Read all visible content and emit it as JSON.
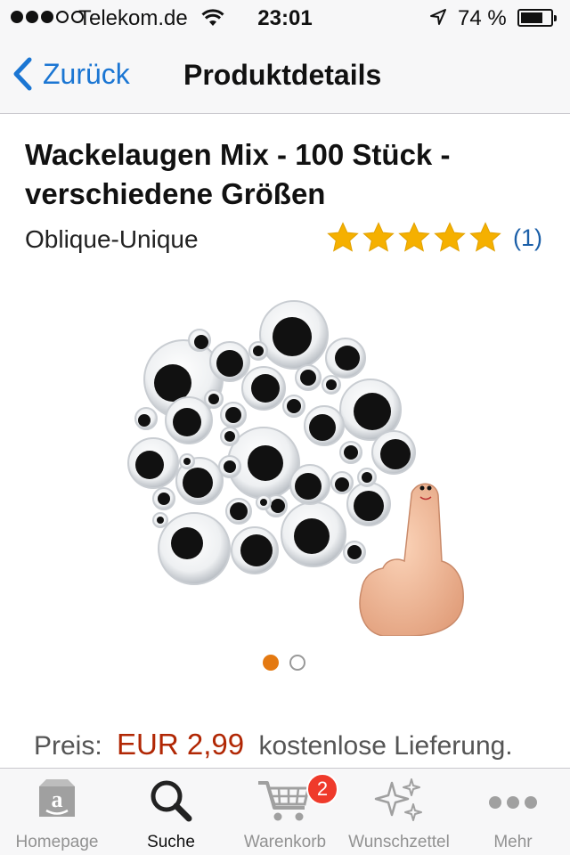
{
  "status_bar": {
    "carrier": "Telekom.de",
    "time": "23:01",
    "battery_percent": "74 %",
    "battery_level": 0.74,
    "signal_bars_filled": 3,
    "signal_bars_total": 5
  },
  "nav": {
    "back_label": "Zurück",
    "title": "Produktdetails"
  },
  "product": {
    "title": "Wackelaugen Mix - 100 Stück - verschiedene Größen",
    "brand": "Oblique-Unique",
    "rating_stars": 5,
    "review_count": "(1)",
    "image_icon": "googly-eyes-product-photo",
    "gallery": {
      "current_index": 1,
      "total": 2
    },
    "price_label": "Preis:",
    "price": "EUR 2,99",
    "delivery": "kostenlose Lieferung."
  },
  "tabs": [
    {
      "label": "Homepage",
      "icon": "amazon-box-icon",
      "active": false
    },
    {
      "label": "Suche",
      "icon": "search-icon",
      "active": true
    },
    {
      "label": "Warenkorb",
      "icon": "cart-icon",
      "active": false,
      "badge": "2"
    },
    {
      "label": "Wunschzettel",
      "icon": "sparkles-icon",
      "active": false
    },
    {
      "label": "Mehr",
      "icon": "more-dots-icon",
      "active": false
    }
  ],
  "colors": {
    "link": "#1b76d3",
    "price": "#b12704",
    "star": "#f5b000",
    "pager_active": "#e47911",
    "badge": "#ef3a2b"
  }
}
